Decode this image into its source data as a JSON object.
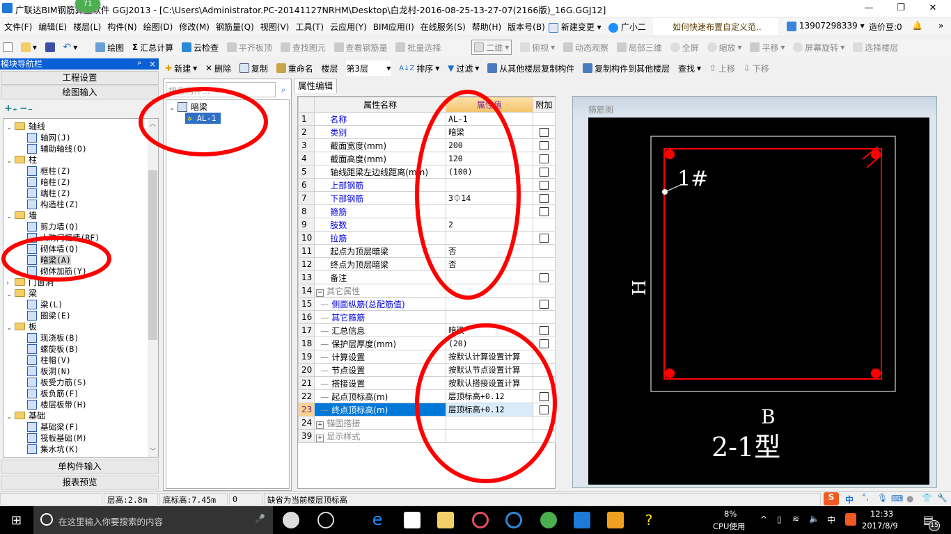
{
  "window": {
    "title": "广联达BIM钢筋算量软件 GGJ2013 - [C:\\Users\\Administrator.PC-20141127NRHM\\Desktop\\白龙村-2016-08-25-13-27-07(2166版)_16G.GGJ12]",
    "badge": "71",
    "minimize": "—",
    "restore": "❐",
    "close": "✕"
  },
  "menu": {
    "items": [
      "文件(F)",
      "编辑(E)",
      "楼层(L)",
      "构件(N)",
      "绘图(D)",
      "修改(M)",
      "钢筋量(Q)",
      "视图(V)",
      "工具(T)",
      "云应用(Y)",
      "BIM应用(I)",
      "在线服务(S)",
      "帮助(H)",
      "版本号(B)"
    ],
    "new_change": "新建变更",
    "assistant": "广小二",
    "tip": "如何快速布置自定义范..",
    "account": "13907298339",
    "beans": "造价豆:0"
  },
  "toolbar1": {
    "draw": "绘图",
    "sum_calc": "汇总计算",
    "cloud_check": "云检查",
    "align_top": "平齐板顶",
    "find_element": "查找图元",
    "view_rebar": "查看钢筋量",
    "batch_select": "批量选择",
    "view_mode": "二维",
    "top_view": "俯视",
    "dynamic_view": "动态观察",
    "local_3d": "局部三维",
    "fullscreen": "全屏",
    "zoom": "缩放",
    "pan": "平移",
    "rotate": "屏幕旋转",
    "select_floor": "选择楼层"
  },
  "nav": {
    "title": "模块导航栏",
    "project_settings": "工程设置",
    "drawing_input": "绘图输入",
    "single_input": "单构件输入",
    "report_preview": "报表预览",
    "tree": [
      {
        "label": "轴线",
        "level": 0,
        "type": "folder",
        "open": true
      },
      {
        "label": "轴网(J)",
        "level": 1
      },
      {
        "label": "辅助轴线(O)",
        "level": 1
      },
      {
        "label": "柱",
        "level": 0,
        "type": "folder",
        "open": true
      },
      {
        "label": "框柱(Z)",
        "level": 1
      },
      {
        "label": "暗柱(Z)",
        "level": 1
      },
      {
        "label": "端柱(Z)",
        "level": 1
      },
      {
        "label": "构造柱(Z)",
        "level": 1
      },
      {
        "label": "墙",
        "level": 0,
        "type": "folder",
        "open": true
      },
      {
        "label": "剪力墙(Q)",
        "level": 1
      },
      {
        "label": "人防门框墙(RF)",
        "level": 1
      },
      {
        "label": "砌体墙(Q)",
        "level": 1
      },
      {
        "label": "暗梁(A)",
        "level": 1,
        "selected": true
      },
      {
        "label": "砌体加筋(Y)",
        "level": 1
      },
      {
        "label": "门窗洞",
        "level": 0,
        "type": "folder",
        "open": false
      },
      {
        "label": "梁",
        "level": 0,
        "type": "folder",
        "open": true
      },
      {
        "label": "梁(L)",
        "level": 1
      },
      {
        "label": "圈梁(E)",
        "level": 1
      },
      {
        "label": "板",
        "level": 0,
        "type": "folder",
        "open": true
      },
      {
        "label": "现浇板(B)",
        "level": 1
      },
      {
        "label": "螺旋板(B)",
        "level": 1
      },
      {
        "label": "柱帽(V)",
        "level": 1
      },
      {
        "label": "板洞(N)",
        "level": 1
      },
      {
        "label": "板受力筋(S)",
        "level": 1
      },
      {
        "label": "板负筋(F)",
        "level": 1
      },
      {
        "label": "楼层板带(H)",
        "level": 1
      },
      {
        "label": "基础",
        "level": 0,
        "type": "folder",
        "open": true
      },
      {
        "label": "基础梁(F)",
        "level": 1
      },
      {
        "label": "筏板基础(M)",
        "level": 1
      },
      {
        "label": "集水坑(K)",
        "level": 1
      }
    ]
  },
  "toolbar2": {
    "new": "新建",
    "delete": "删除",
    "copy": "复制",
    "rename": "重命名",
    "floor_label": "楼层",
    "floor_value": "第3层",
    "sort": "排序",
    "filter": "过滤",
    "copy_from_floor": "从其他楼层复制构件",
    "copy_to_floor": "复制构件到其他楼层",
    "find": "查找",
    "move_up": "上移",
    "move_down": "下移"
  },
  "component_list": {
    "search_placeholder": "搜索构件...",
    "group": "暗梁",
    "item": "AL-1"
  },
  "properties": {
    "tab": "属性编辑",
    "headers": {
      "name": "属性名称",
      "value": "属性值",
      "extra": "附加"
    },
    "rows": [
      {
        "n": "1",
        "name": "名称",
        "value": "AL-1",
        "style": "blue",
        "cb": false
      },
      {
        "n": "2",
        "name": "类别",
        "value": "暗梁",
        "style": "blue",
        "cb": true
      },
      {
        "n": "3",
        "name": "截面宽度(mm)",
        "value": "200",
        "cb": true
      },
      {
        "n": "4",
        "name": "截面高度(mm)",
        "value": "120",
        "cb": true
      },
      {
        "n": "5",
        "name": "轴线距梁左边线距离(mm)",
        "value": "(100)",
        "cb": true
      },
      {
        "n": "6",
        "name": "上部钢筋",
        "value": "",
        "style": "blue",
        "cb": true
      },
      {
        "n": "7",
        "name": "下部钢筋",
        "value": "3⏀14",
        "style": "blue",
        "cb": true
      },
      {
        "n": "8",
        "name": "箍筋",
        "value": "",
        "style": "blue",
        "cb": true
      },
      {
        "n": "9",
        "name": "肢数",
        "value": "2",
        "style": "blue",
        "cb": false
      },
      {
        "n": "10",
        "name": "拉筋",
        "value": "",
        "style": "blue",
        "cb": true
      },
      {
        "n": "11",
        "name": "起点为顶层暗梁",
        "value": "否",
        "cb": false
      },
      {
        "n": "12",
        "name": "终点为顶层暗梁",
        "value": "否",
        "cb": false
      },
      {
        "n": "13",
        "name": "备注",
        "value": "",
        "cb": true
      },
      {
        "n": "14",
        "name": "其它属性",
        "value": "",
        "style": "gray",
        "expander": "−",
        "cb": false
      },
      {
        "n": "15",
        "name": "侧面纵筋(总配筋值)",
        "value": "",
        "style": "blue",
        "child": true,
        "cb": true
      },
      {
        "n": "16",
        "name": "其它箍筋",
        "value": "",
        "style": "blue",
        "child": true,
        "cb": false
      },
      {
        "n": "17",
        "name": "汇总信息",
        "value": "暗梁",
        "child": true,
        "cb": true
      },
      {
        "n": "18",
        "name": "保护层厚度(mm)",
        "value": "(20)",
        "child": true,
        "cb": true
      },
      {
        "n": "19",
        "name": "计算设置",
        "value": "按默认计算设置计算",
        "child": true,
        "cb": false
      },
      {
        "n": "20",
        "name": "节点设置",
        "value": "按默认节点设置计算",
        "child": true,
        "cb": false
      },
      {
        "n": "21",
        "name": "搭接设置",
        "value": "按默认搭接设置计算",
        "child": true,
        "cb": false
      },
      {
        "n": "22",
        "name": "起点顶标高(m)",
        "value": "层顶标高+0.12",
        "child": true,
        "cb": true
      },
      {
        "n": "23",
        "name": "终点顶标高(m)",
        "value": "层顶标高+0.12",
        "child": true,
        "cb": true,
        "selected": true
      },
      {
        "n": "24",
        "name": "锚固搭接",
        "value": "",
        "style": "gray",
        "expander": "+",
        "cb": false
      },
      {
        "n": "39",
        "name": "显示样式",
        "value": "",
        "style": "gray",
        "expander": "+",
        "cb": false
      }
    ]
  },
  "stirrup_view": {
    "title": "箍筋图",
    "rebar_label": "1#",
    "height_label": "H",
    "width_label": "B",
    "type_label": "2-1型",
    "rebar_color": "#ff0000"
  },
  "status": {
    "floor_height": "层高:2.8m",
    "base_elevation": "底标高:7.45m",
    "value": "0",
    "hint": "缺省为当前楼层顶标高",
    "ime": "中"
  },
  "taskbar": {
    "search_placeholder": "在这里输入你要搜索的内容",
    "cpu_percent": "8%",
    "cpu_label": "CPU使用",
    "ime": "中",
    "time": "12:33",
    "date": "2017/8/9",
    "notifications": "15"
  },
  "annotation_color": "#ff0000"
}
